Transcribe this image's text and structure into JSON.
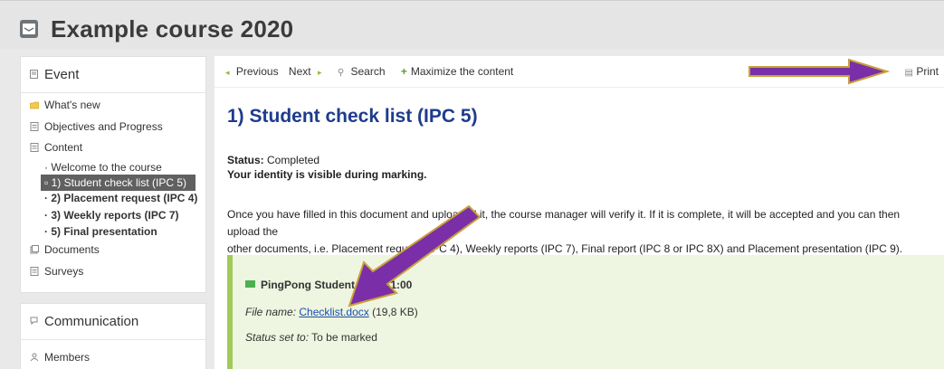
{
  "header": {
    "title": "Example course 2020"
  },
  "sidebar": {
    "event": {
      "heading": "Event",
      "items": [
        {
          "label": "What's new",
          "icon": "folder-icon"
        },
        {
          "label": "Objectives and Progress",
          "icon": "page-icon"
        },
        {
          "label": "Content",
          "icon": "page-icon"
        }
      ],
      "content_items": [
        {
          "label": "Welcome to the course",
          "bullet": "·"
        },
        {
          "label": "1) Student check list (IPC 5)",
          "bullet": "▫"
        },
        {
          "label": "2) Placement request (IPC 4)",
          "bullet": "·"
        },
        {
          "label": "3) Weekly reports (IPC 7)",
          "bullet": "·"
        },
        {
          "label": "5) Final presentation",
          "bullet": "·"
        }
      ],
      "after_items": [
        {
          "label": "Documents",
          "icon": "docs-icon"
        },
        {
          "label": "Surveys",
          "icon": "page-icon"
        }
      ]
    },
    "communication": {
      "heading": "Communication",
      "items": [
        {
          "label": "Members",
          "icon": "members-icon"
        }
      ]
    }
  },
  "toolbar": {
    "previous": "Previous",
    "next": "Next",
    "search": "Search",
    "maximize": "Maximize the content",
    "print": "Print"
  },
  "main": {
    "title": "1) Student check list (IPC 5)",
    "status_label": "Status:",
    "status_value": "Completed",
    "identity": "Your identity is visible during marking.",
    "paragraph_line1": "Once you have filled in this document and uploaded it, the course manager will verify it. If it is complete, it will be accepted and you can then upload the",
    "paragraph_line2": "other documents, i.e. Placement request (IPC 4), Weekly reports (IPC 7), Final report (IPC 8 or IPC 8X) and Placement presentation (IPC 9)."
  },
  "submission": {
    "author": "PingPong Student , T",
    "time": "11:00",
    "file_label": "File name:",
    "file_name": "Checklist.docx",
    "file_size": "(19,8 KB)",
    "status_label": "Status set to:",
    "status_value": "To be marked"
  },
  "colors": {
    "title_blue": "#1d3c8c",
    "arrow_purple": "#7a2fa8",
    "arrow_outline": "#c8a13a",
    "submission_bg": "#eef5e0",
    "submission_border": "#a3c95a"
  }
}
